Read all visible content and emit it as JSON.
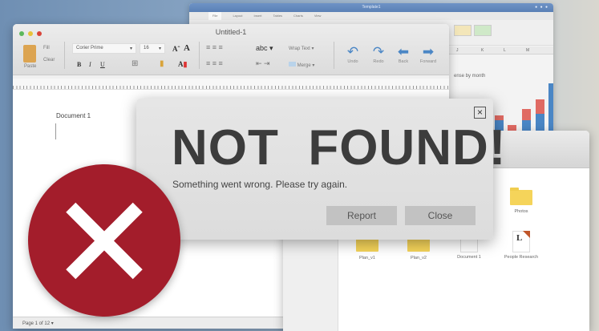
{
  "spreadsheet": {
    "title": "Template1",
    "tabs": [
      "File",
      "Layout",
      "Insert",
      "Tables",
      "Charts",
      "View"
    ],
    "columns": [
      "J",
      "K",
      "L",
      "M"
    ],
    "chart_title": "ense by month",
    "colors": {
      "blue": "#4a86c5",
      "red": "#e06a63"
    }
  },
  "word": {
    "title": "Untitled-1",
    "paste_label": "Paste",
    "fill_label": "Fill",
    "clear_label": "Clear",
    "font": "Corier Prime",
    "font_size": "16",
    "bold": "B",
    "italic": "I",
    "underline": "U",
    "abc_label": "abc",
    "wrap_text": "Wrap Text",
    "merge": "Merge",
    "undo": "Undo",
    "redo": "Redo",
    "back": "Back",
    "forward": "Forward",
    "document_label": "Document 1",
    "page_status": "Page 1 of 12"
  },
  "finder": {
    "items": [
      {
        "label": "Photos",
        "icon": "folder-icon"
      },
      {
        "label": "Plan_v1",
        "icon": "folder-icon"
      },
      {
        "label": "Plan_v2",
        "icon": "folder-icon"
      },
      {
        "label": "Document 1",
        "icon": "document-icon"
      },
      {
        "label": "People Research",
        "icon": "document-icon"
      }
    ]
  },
  "dialog": {
    "headline": "NOT  FOUND!",
    "message": "Something went wrong. Please try again.",
    "report": "Report",
    "close": "Close",
    "close_icon": "×"
  },
  "error_icon": {
    "color": "#a31d2b"
  }
}
